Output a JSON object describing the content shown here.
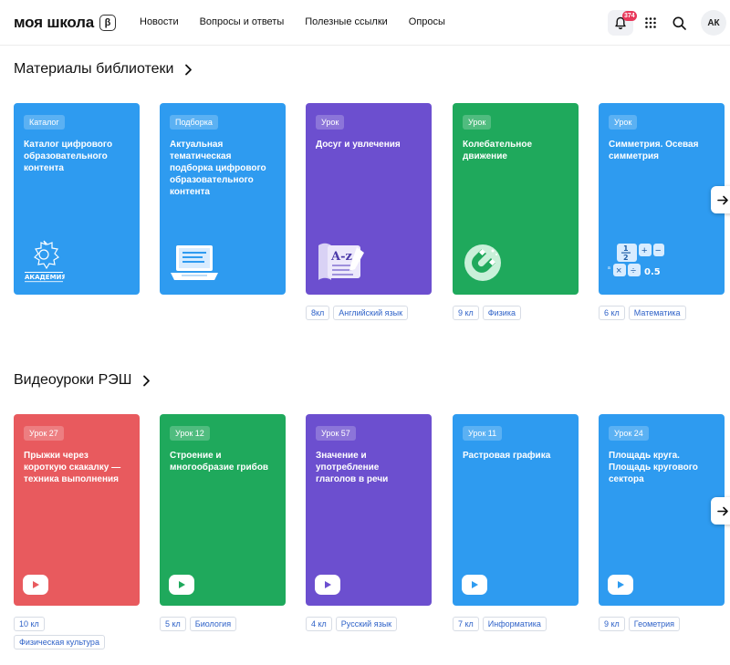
{
  "header": {
    "logo": "моя школа",
    "beta": "β",
    "nav": [
      "Новости",
      "Вопросы и ответы",
      "Полезные ссылки",
      "Опросы"
    ],
    "notifications_count": "374",
    "avatar_initials": "АК"
  },
  "library": {
    "title": "Материалы библиотеки",
    "cards": [
      {
        "tag": "Каталог",
        "title": "Каталог цифрового образовательного контента",
        "color": "#2e9bf0",
        "chips": []
      },
      {
        "tag": "Подборка",
        "title": "Актуальная тематическая подборка цифрового образовательного контента",
        "color": "#2e9bf0",
        "chips": []
      },
      {
        "tag": "Урок",
        "title": "Досуг и увлечения",
        "color": "#6c4fcf",
        "chips": [
          "8кл",
          "Английский язык"
        ]
      },
      {
        "tag": "Урок",
        "title": "Колебательное движение",
        "color": "#1fa95c",
        "chips": [
          "9 кл",
          "Физика"
        ]
      },
      {
        "tag": "Урок",
        "title": "Симметрия. Осевая симметрия",
        "color": "#2e9bf0",
        "chips": [
          "6 кл",
          "Математика"
        ]
      }
    ]
  },
  "videos": {
    "title": "Видеоуроки РЭШ",
    "cards": [
      {
        "tag": "Урок 27",
        "title": "Прыжки через короткую скакалку — техника выполнения",
        "color": "#e85a5e",
        "chips": [
          "10 кл",
          "Физическая культура"
        ]
      },
      {
        "tag": "Урок 12",
        "title": "Строение и многообразие грибов",
        "color": "#1fa95c",
        "chips": [
          "5 кл",
          "Биология"
        ]
      },
      {
        "tag": "Урок 57",
        "title": "Значение и употребление глаголов в речи",
        "color": "#6c4fcf",
        "chips": [
          "4 кл",
          "Русский язык"
        ]
      },
      {
        "tag": "Урок 11",
        "title": "Растровая графика",
        "color": "#2e9bf0",
        "chips": [
          "7 кл",
          "Информатика"
        ]
      },
      {
        "tag": "Урок 24",
        "title": "Площадь круга. Площадь кругового сектора",
        "color": "#2e9bf0",
        "chips": [
          "9 кл",
          "Геометрия"
        ]
      }
    ]
  },
  "icons": {
    "chevron": "chevron-right-icon",
    "next": "arrow-right-icon",
    "play": "play-icon"
  }
}
